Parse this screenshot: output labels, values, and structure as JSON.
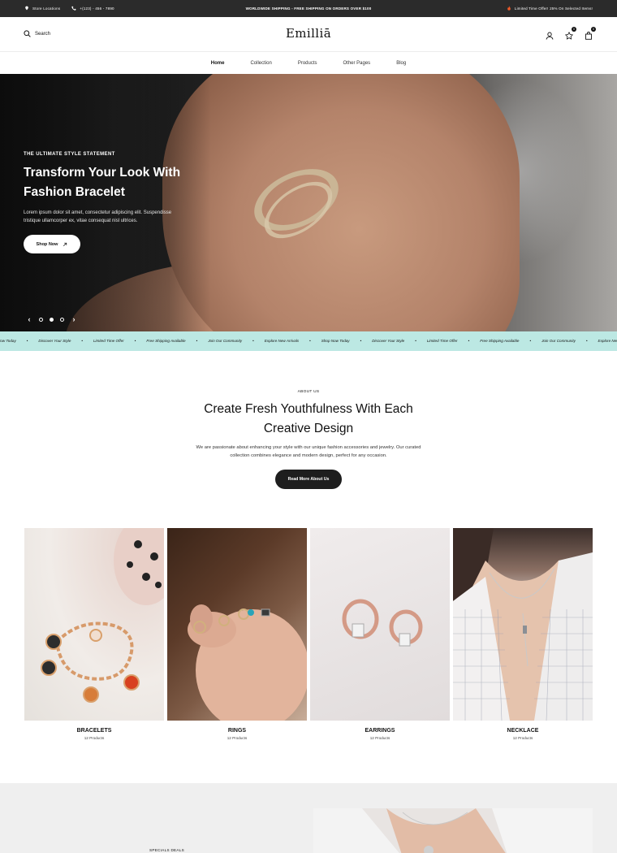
{
  "topbar": {
    "store": "Store Locations",
    "phone": "+(123) - 456 - 7890",
    "shipping": "WORLDWIDE SHIPPING - FREE SHIPPING ON ORDERS OVER $100",
    "offer": "Limited Time Offer! 25% On Selected Items!"
  },
  "header": {
    "search": "Search",
    "logo": "Emilliā",
    "wishlist_count": "0",
    "cart_count": "0"
  },
  "nav": [
    "Home",
    "Collection",
    "Products",
    "Other Pages",
    "Blog"
  ],
  "hero": {
    "eyebrow": "THE ULTIMATE STYLE STATEMENT",
    "title": "Transform Your Look With Fashion Bracelet",
    "desc": "Lorem ipsum dolor sit amet, consectetur adipiscing elit. Suspendisse tristique ullamcorper ex, vitae consequat nisl ultrices.",
    "button": "Shop Now"
  },
  "marquee": [
    "hop Now Today",
    "Discover Your Style",
    "Limited Time Offer",
    "Free Shipping Available",
    "Join Our Community",
    "Explore New Arrivals",
    "Shop Now Today",
    "Discover Your Style",
    "Limited Time Offer",
    "Free Shipping Available",
    "Join Our Community",
    "Explore New Arrivals"
  ],
  "about": {
    "eyebrow": "ABOUT US",
    "title": "Create Fresh Youthfulness With Each Creative Design",
    "desc": "We are passionate about enhancing your style with our unique fashion accessories and jewelry. Our curated collection combines elegance and modern design, perfect for any occasion.",
    "button": "Read More About Us"
  },
  "categories": [
    {
      "name": "BRACELETS",
      "count": "12 Products"
    },
    {
      "name": "RINGS",
      "count": "12 Products"
    },
    {
      "name": "EARRINGS",
      "count": "12 Products"
    },
    {
      "name": "NECKLACE",
      "count": "12 Products"
    }
  ],
  "specials": "SPECIALS DEALS",
  "colors": {
    "accent_mint": "#bce8e3",
    "dark": "#1e1e1e",
    "topbar": "#2b2b2b"
  }
}
